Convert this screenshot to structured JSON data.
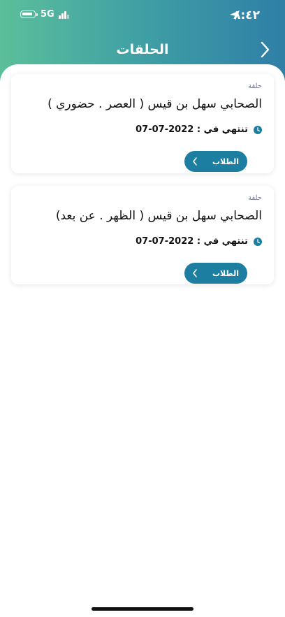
{
  "status_bar": {
    "time": "٨:٤٢",
    "network": "5G",
    "icons": [
      "battery-icon",
      "signal-icon",
      "location-arrow-icon"
    ]
  },
  "header": {
    "title": "الحلقات",
    "back_icon": "chevron-right-icon",
    "gradient": [
      "#5bbf9a",
      "#2f7fa6"
    ]
  },
  "circles": [
    {
      "type_label": "حلقة",
      "title": "الصحابي سهل بن قيس ( العصر . حضوري )",
      "ends_label": "تنتهي في : 2022-07-07",
      "button_label": "الطلاب"
    },
    {
      "type_label": "حلقة",
      "title": "الصحابي سهل بن قيس ( الظهر . عن بعد)",
      "ends_label": "تنتهي في : 2022-07-07",
      "button_label": "الطلاب"
    }
  ],
  "colors": {
    "accent": "#1c7ea0",
    "type_label": "#6f7fa0"
  }
}
